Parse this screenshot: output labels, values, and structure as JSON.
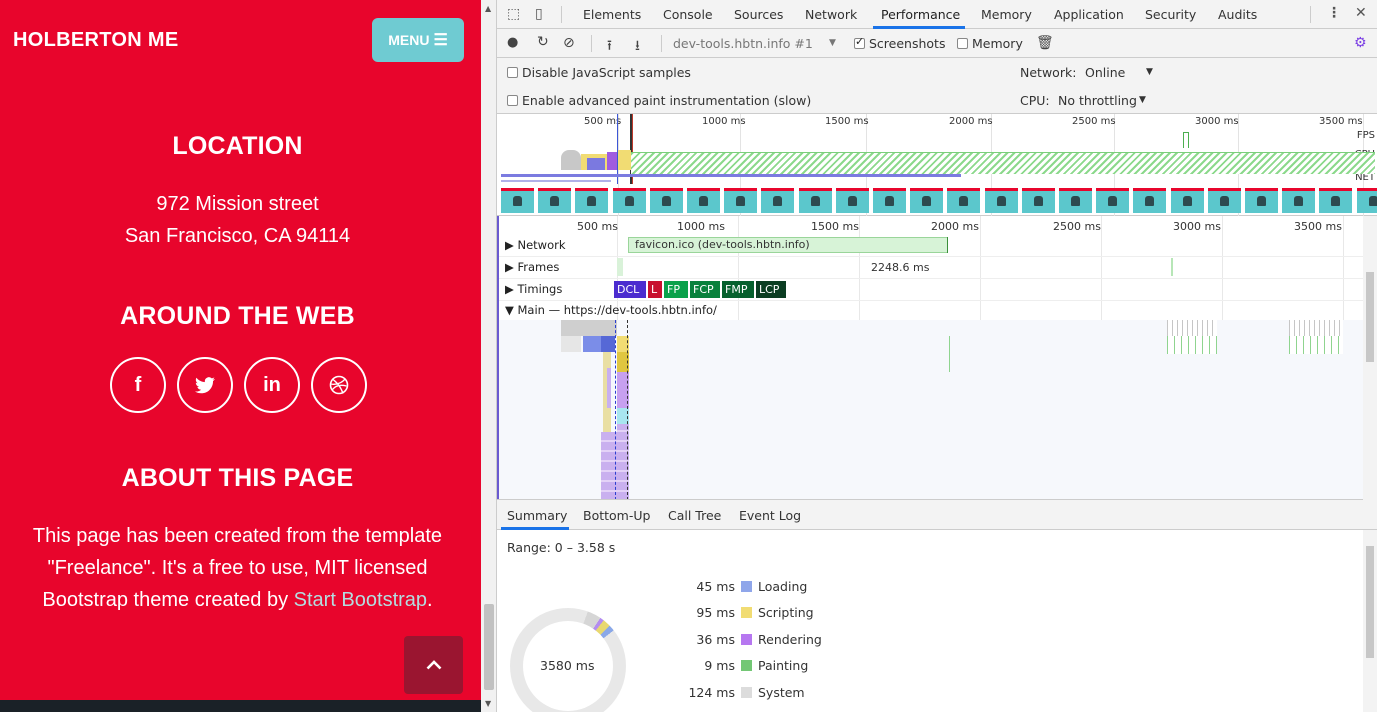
{
  "site": {
    "brand": "HOLBERTON ME",
    "menu_label": "MENU",
    "location_heading": "LOCATION",
    "address_line1": "972 Mission street",
    "address_line2": "San Francisco, CA 94114",
    "web_heading": "AROUND THE WEB",
    "social": {
      "facebook": "f",
      "twitter": "t",
      "linkedin": "in"
    },
    "about_heading": "ABOUT THIS PAGE",
    "about_line1": "This page has been created from the template",
    "about_line2": "\"Freelance\". It's a free to use, MIT licensed",
    "about_line3_prefix": "Bootstrap theme created by ",
    "about_link": "Start Bootstrap",
    "about_line3_suffix": ".",
    "colors": {
      "background": "#e8052c",
      "menu": "#6fcbd2",
      "link": "#b4dde0"
    }
  },
  "devtools": {
    "tabs": [
      "Elements",
      "Console",
      "Sources",
      "Network",
      "Performance",
      "Memory",
      "Application",
      "Security",
      "Audits"
    ],
    "active_tab": "Performance",
    "recording_select": "dev-tools.hbtn.info #1",
    "screenshots_label": "Screenshots",
    "memory_label": "Memory",
    "disable_js_label": "Disable JavaScript samples",
    "paint_label": "Enable advanced paint instrumentation (slow)",
    "network_label": "Network:",
    "network_value": "Online",
    "cpu_label": "CPU:",
    "cpu_value": "No throttling",
    "overview_ticks": [
      "500 ms",
      "1000 ms",
      "1500 ms",
      "2000 ms",
      "2500 ms",
      "3000 ms",
      "3500 ms"
    ],
    "overview_rows": [
      "FPS",
      "CPU",
      "NET"
    ],
    "track_ticks": [
      "500 ms",
      "1000 ms",
      "1500 ms",
      "2000 ms",
      "2500 ms",
      "3000 ms",
      "3500 ms"
    ],
    "tracks": {
      "network": "Network",
      "network_item": "favicon.ico (dev-tools.hbtn.info)",
      "frames": "Frames",
      "frame_duration": "2248.6 ms",
      "timings": "Timings",
      "timing_marks": [
        {
          "label": "DCL",
          "color": "#4b2ccf"
        },
        {
          "label": "L",
          "color": "#c8102e"
        },
        {
          "label": "FP",
          "color": "#0aa14a"
        },
        {
          "label": "FCP",
          "color": "#08813c"
        },
        {
          "label": "FMP",
          "color": "#06602d"
        },
        {
          "label": "LCP",
          "color": "#0b3d22"
        }
      ],
      "main": "Main — https://dev-tools.hbtn.info/"
    },
    "bottom_tabs": [
      "Summary",
      "Bottom-Up",
      "Call Tree",
      "Event Log"
    ],
    "range": "Range: 0 – 3.58 s",
    "total": "3580 ms",
    "summary": [
      {
        "value": "45 ms",
        "label": "Loading",
        "color": "#8fa6ea"
      },
      {
        "value": "95 ms",
        "label": "Scripting",
        "color": "#f1dc73"
      },
      {
        "value": "36 ms",
        "label": "Rendering",
        "color": "#b677f0"
      },
      {
        "value": "9 ms",
        "label": "Painting",
        "color": "#73c775"
      },
      {
        "value": "124 ms",
        "label": "System",
        "color": "#dcdcdc"
      }
    ]
  }
}
